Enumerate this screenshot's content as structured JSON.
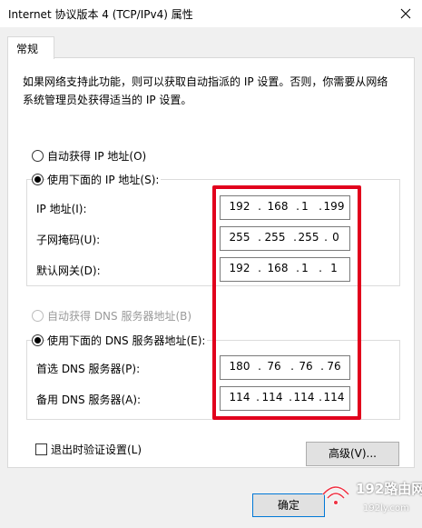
{
  "window": {
    "title": "Internet 协议版本 4 (TCP/IPv4) 属性"
  },
  "tabs": [
    {
      "label": "常规"
    }
  ],
  "description": "如果网络支持此功能，则可以获取自动指派的 IP 设置。否则，你需要从网络系统管理员处获得适当的 IP 设置。",
  "ip_mode": {
    "auto_label": "自动获得 IP 地址(O)",
    "manual_label": "使用下面的 IP 地址(S):",
    "selected": "manual"
  },
  "ip_fields": [
    {
      "label": "IP 地址(I):",
      "octets": [
        "192",
        "168",
        "1",
        "199"
      ]
    },
    {
      "label": "子网掩码(U):",
      "octets": [
        "255",
        "255",
        "255",
        "0"
      ]
    },
    {
      "label": "默认网关(D):",
      "octets": [
        "192",
        "168",
        "1",
        "1"
      ]
    }
  ],
  "dns_mode": {
    "auto_label": "自动获得 DNS 服务器地址(B)",
    "manual_label": "使用下面的 DNS 服务器地址(E):",
    "selected": "manual"
  },
  "dns_fields": [
    {
      "label": "首选 DNS 服务器(P):",
      "octets": [
        "180",
        "76",
        "76",
        "76"
      ]
    },
    {
      "label": "备用 DNS 服务器(A):",
      "octets": [
        "114",
        "114",
        "114",
        "114"
      ]
    }
  ],
  "validate_label": "退出时验证设置(L)",
  "advanced_label": "高级(V)...",
  "ok_label": "确定",
  "watermark": {
    "text": "192路由网",
    "sub": "192ly.com"
  },
  "colors": {
    "highlight": "#e1001c",
    "accent": "#0078d7"
  }
}
